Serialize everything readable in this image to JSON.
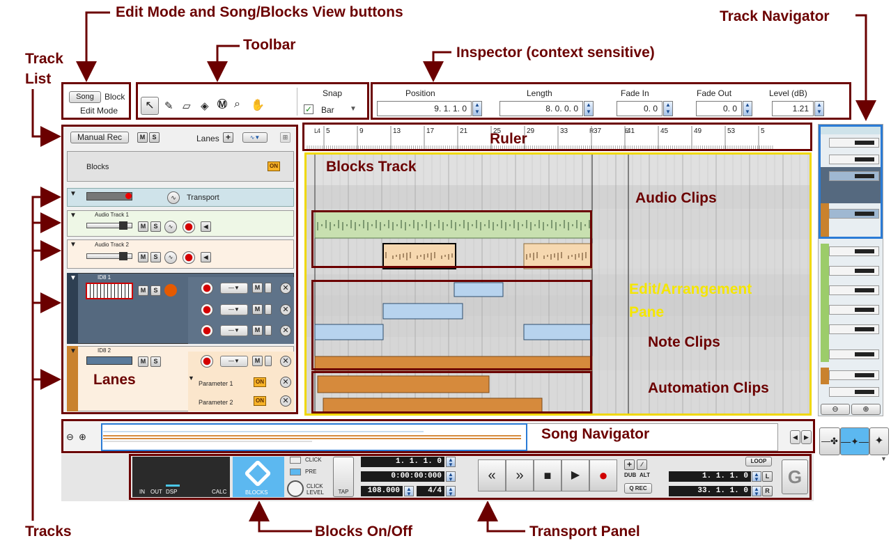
{
  "callouts": {
    "edit_mode_views": "Edit Mode and Song/Blocks View buttons",
    "toolbar": "Toolbar",
    "inspector": "Inspector (context sensitive)",
    "track_navigator": "Track Navigator",
    "track_list_line1": "Track",
    "track_list_line2": "List",
    "ruler": "Ruler",
    "blocks_track": "Blocks Track",
    "audio_clips": "Audio Clips",
    "edit_pane_line1": "Edit/Arrangement",
    "edit_pane_line2": "Pane",
    "note_clips": "Note Clips",
    "lanes": "Lanes",
    "automation_clips": "Automation Clips",
    "song_navigator": "Song Navigator",
    "tracks": "Tracks",
    "blocks_onoff": "Blocks On/Off",
    "transport_panel": "Transport Panel"
  },
  "mode": {
    "song": "Song",
    "block": "Block",
    "edit_mode": "Edit Mode"
  },
  "snap": {
    "label": "Snap",
    "value": "Bar",
    "checked": true
  },
  "inspector": {
    "fields": [
      {
        "label": "Position",
        "value": "9.  1.  1.      0"
      },
      {
        "label": "Length",
        "value": "8.  0.  0.      0"
      },
      {
        "label": "Fade In",
        "value": "0.      0"
      },
      {
        "label": "Fade Out",
        "value": "0.      0"
      },
      {
        "label": "Level (dB)",
        "value": "1.21"
      }
    ]
  },
  "tracklist_header": {
    "manual_rec": "Manual Rec",
    "m": "M",
    "s": "S",
    "lanes": "Lanes",
    "plus": "+"
  },
  "tracks": {
    "blocks": {
      "name": "Blocks",
      "on": "ON"
    },
    "transport": {
      "name": "Transport"
    },
    "audio1": {
      "name": "Audio Track 1"
    },
    "audio2": {
      "name": "Audio Track 2"
    },
    "id8_1": {
      "name": "ID8 1"
    },
    "id8_2": {
      "name": "ID8 2"
    },
    "param1": {
      "name": "Parameter 1",
      "on": "ON"
    },
    "param2": {
      "name": "Parameter 2",
      "on": "ON"
    }
  },
  "ruler": {
    "bars": [
      "5",
      "9",
      "13",
      "17",
      "21",
      "25",
      "29",
      "33",
      "37",
      "41",
      "45",
      "49",
      "53",
      "5"
    ],
    "markers": {
      "left": "L",
      "right": "R",
      "end": "E",
      "left_sub": "4"
    }
  },
  "transport": {
    "meter": {
      "in": "IN",
      "out": "OUT",
      "dsp": "DSP",
      "calc": "CALC"
    },
    "blocks_button": "BLOCKS",
    "click": "CLICK",
    "pre": "PRE",
    "click_level_1": "CLICK",
    "click_level_2": "LEVEL",
    "tap": "TAP",
    "position": "1.  1.  1.    0",
    "time": "0:00:00:000",
    "tempo": "108.000",
    "signature": "4/4",
    "dub": "DUB",
    "alt": "ALT",
    "qrec": "Q REC",
    "loop": "LOOP",
    "loop_left": "1.  1.  1.    0",
    "loop_right": "33.  1.  1.    0",
    "l": "L",
    "r": "R"
  },
  "colors": {
    "callout": "#6b0000",
    "edit_pane_frame": "#f0d800",
    "audio_clip_green": "#c8e0b0",
    "audio_clip_peach": "#f6d8b0",
    "note_clip_blue": "#b7d3ee",
    "automation_orange": "#d68a3c",
    "track_orange": "#c9822e",
    "track_slate": "#55697f"
  }
}
